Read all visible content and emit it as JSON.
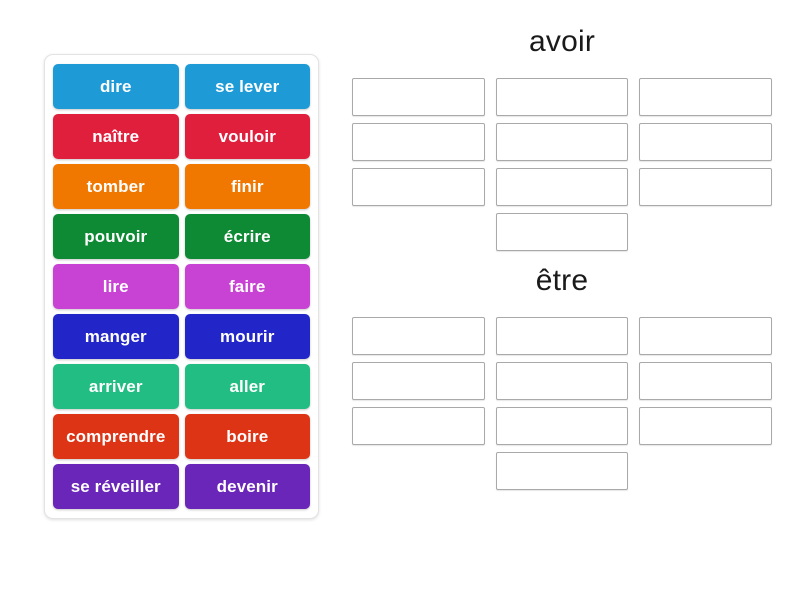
{
  "activity": {
    "type": "group-sort",
    "tiles_panel": {
      "name": "word-tiles-panel",
      "columns": 2,
      "tiles": [
        {
          "label": "dire",
          "color": "#1e9bd7"
        },
        {
          "label": "se lever",
          "color": "#1e9bd7"
        },
        {
          "label": "naître",
          "color": "#e01f3d"
        },
        {
          "label": "vouloir",
          "color": "#e01f3d"
        },
        {
          "label": "tomber",
          "color": "#f07800"
        },
        {
          "label": "finir",
          "color": "#f07800"
        },
        {
          "label": "pouvoir",
          "color": "#0f8a34"
        },
        {
          "label": "écrire",
          "color": "#0f8a34"
        },
        {
          "label": "lire",
          "color": "#c843d4"
        },
        {
          "label": "faire",
          "color": "#c843d4"
        },
        {
          "label": "manger",
          "color": "#2226c8"
        },
        {
          "label": "mourir",
          "color": "#2226c8"
        },
        {
          "label": "arriver",
          "color": "#22bd83"
        },
        {
          "label": "aller",
          "color": "#22bd83"
        },
        {
          "label": "comprendre",
          "color": "#de3416"
        },
        {
          "label": "boire",
          "color": "#de3416"
        },
        {
          "label": "se réveiller",
          "color": "#6a26b8"
        },
        {
          "label": "devenir",
          "color": "#6a26b8"
        }
      ]
    },
    "groups": [
      {
        "title": "avoir",
        "slot_count": 10,
        "rows": [
          3,
          3,
          3,
          1
        ],
        "slots_filled": []
      },
      {
        "title": "être",
        "slot_count": 10,
        "rows": [
          3,
          3,
          3,
          1
        ],
        "slots_filled": []
      }
    ]
  },
  "colors": {
    "page_background": "#ffffff",
    "panel_border": "#e3e3e3",
    "slot_border": "#a9a9a9",
    "title_text": "#1a1a1a",
    "tile_text": "#ffffff"
  }
}
